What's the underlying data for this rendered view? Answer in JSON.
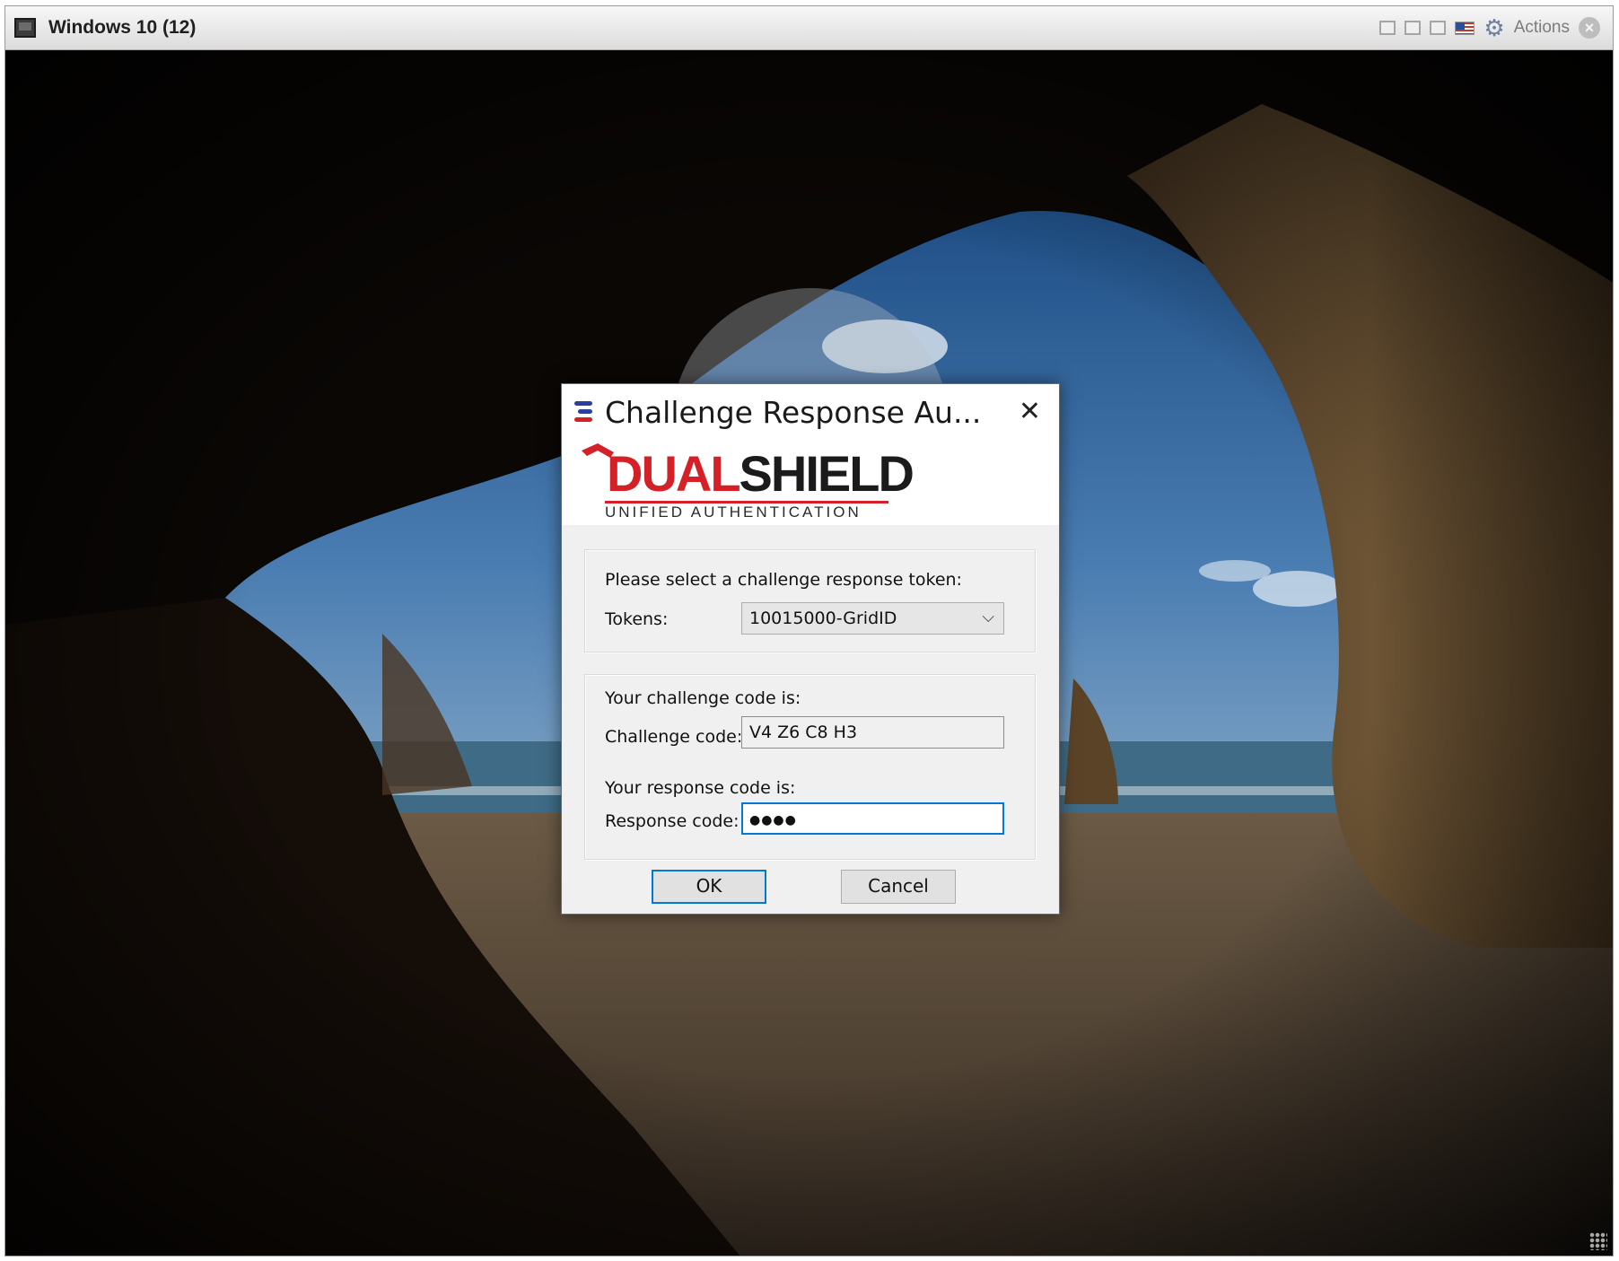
{
  "vm_window": {
    "title": "Windows 10 (12)",
    "actions_label": "Actions",
    "icons": [
      "screen-icon",
      "minimize-window-icon",
      "restore-window-icon",
      "fullscreen-icon",
      "keyboard-flag-icon",
      "gear-icon",
      "close-icon"
    ]
  },
  "dialog": {
    "title": "Challenge Response Au...",
    "close_glyph": "✕",
    "logo": {
      "word_red": "D",
      "word_red2": "UAL",
      "word_dark": "SHIELD",
      "tagline": "UNIFIED AUTHENTICATION"
    },
    "token_group": {
      "prompt": "Please select a challenge response token:",
      "tokens_label": "Tokens:",
      "tokens_value": "10015000-GridID"
    },
    "code_group": {
      "challenge_prompt": "Your challenge code is:",
      "challenge_label": "Challenge code:",
      "challenge_value": "V4 Z6 C8 H3",
      "response_prompt": "Your response code is:",
      "response_label": "Response code:",
      "response_value": "●●●●"
    },
    "buttons": {
      "ok": "OK",
      "cancel": "Cancel"
    }
  },
  "colors": {
    "accent": "#0078d7",
    "brand_red": "#d42026"
  }
}
